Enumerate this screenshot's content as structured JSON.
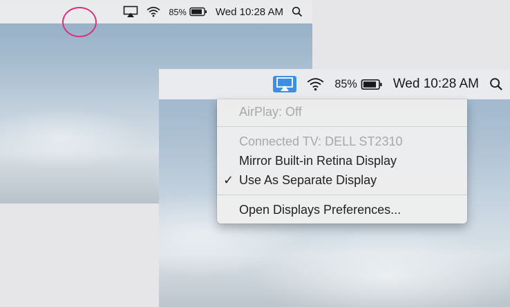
{
  "menubar": {
    "battery_percent": "85%",
    "clock": "Wed 10:28 AM",
    "icons": [
      "airplay-icon",
      "wifi-icon",
      "battery-icon",
      "spotlight-search-icon"
    ]
  },
  "menu": {
    "airplay_status": "AirPlay: Off",
    "connected_tv": "Connected TV: DELL ST2310",
    "mirror_option": "Mirror Built-in Retina Display",
    "separate_option": "Use As Separate Display",
    "separate_checkmark": "✓",
    "open_prefs": "Open Displays Preferences..."
  },
  "colors": {
    "highlight_ring": "#d6317a",
    "airplay_active_bg": "#3d8fe2"
  }
}
